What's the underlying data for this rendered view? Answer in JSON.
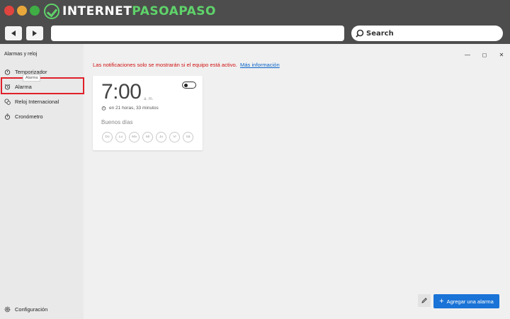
{
  "brand": {
    "text_main": "INTERNET",
    "text_accent": "PASOAPASO"
  },
  "browser": {
    "search_label": "Search",
    "address_value": ""
  },
  "app": {
    "title": "Alarmas y reloj",
    "nav": {
      "timer": "Temporizador",
      "alarm": "Alarma",
      "world_clock": "Reloj Internacional",
      "stopwatch": "Cronómetro",
      "settings": "Configuración"
    },
    "tooltip": "Alarma",
    "window_controls": {
      "minimize": "—",
      "maximize": "◻",
      "close": "✕"
    }
  },
  "notice": {
    "text": "Las notificaciones solo se mostrarán si el equipo está activo.",
    "link": "Más información"
  },
  "alarm_card": {
    "time": "7:00",
    "ampm": "a. m.",
    "enabled": false,
    "countdown": "en 21 horas, 33 minutos",
    "name": "Buenos días",
    "days": [
      "Do",
      "Lu",
      "Ma",
      "Mi",
      "Ju",
      "Vi",
      "Sá"
    ]
  },
  "actions": {
    "add_alarm": "Agregar una alarma"
  },
  "colors": {
    "accent_blue": "#1a73d6",
    "notice_red": "#d01010",
    "highlight_red": "#e0202a",
    "brand_green": "#5fd36a"
  }
}
